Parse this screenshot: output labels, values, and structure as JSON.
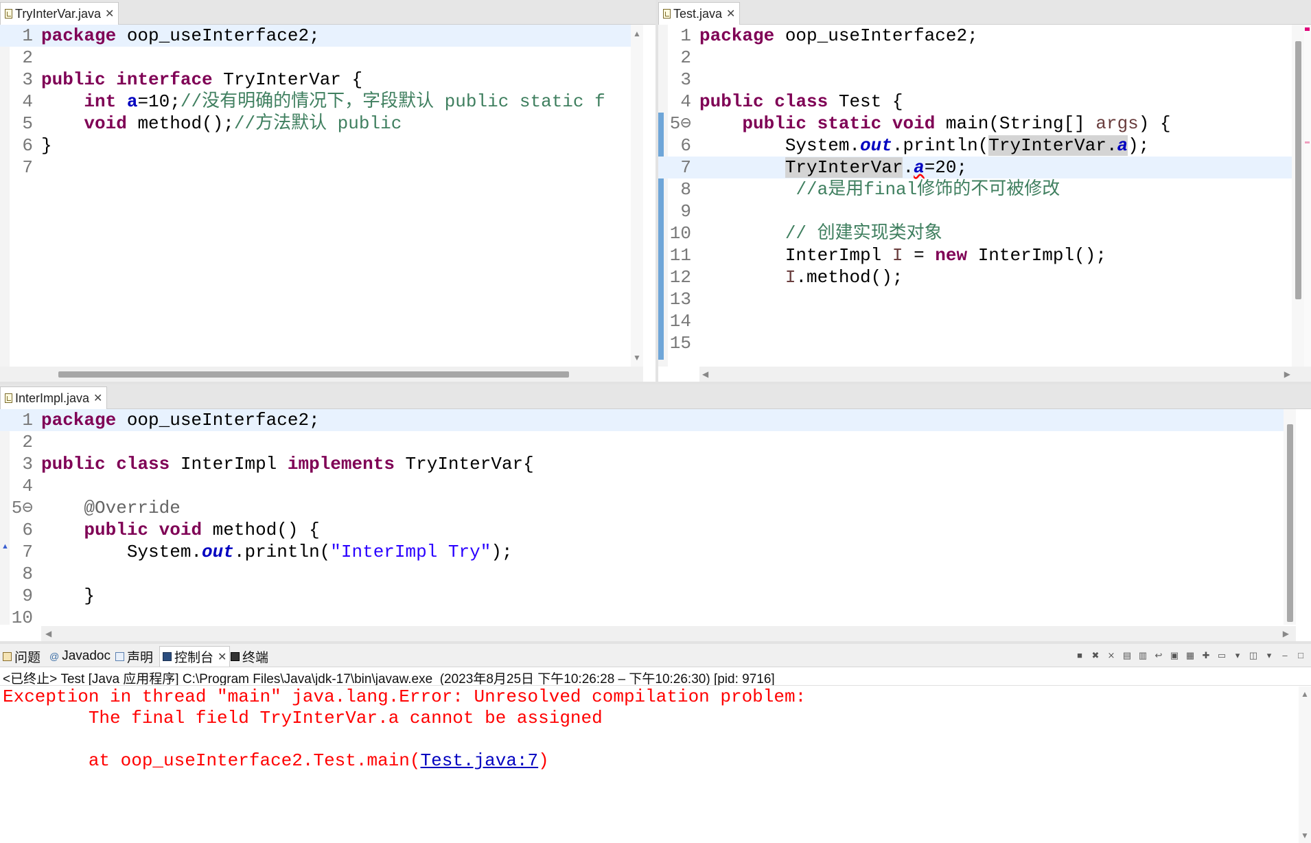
{
  "panes": {
    "try_inter_var": {
      "tab_label": "TryInterVar.java",
      "lines": [
        {
          "n": "1",
          "code": [
            {
              "t": "package",
              "c": "kw"
            },
            {
              "t": " oop_useInterface2;"
            }
          ]
        },
        {
          "n": "2",
          "code": []
        },
        {
          "n": "3",
          "code": [
            {
              "t": "public",
              "c": "kw"
            },
            {
              "t": " "
            },
            {
              "t": "interface",
              "c": "kw"
            },
            {
              "t": " TryInterVar {"
            }
          ]
        },
        {
          "n": "4",
          "code": [
            {
              "t": "    "
            },
            {
              "t": "int",
              "c": "kw"
            },
            {
              "t": " "
            },
            {
              "t": "a",
              "c": "fv"
            },
            {
              "t": "=10;"
            },
            {
              "t": "//没有明确的情况下，字段默认 public static f",
              "c": "cm"
            }
          ]
        },
        {
          "n": "5",
          "code": [
            {
              "t": "    "
            },
            {
              "t": "void",
              "c": "kw"
            },
            {
              "t": " method();"
            },
            {
              "t": "//方法默认 public",
              "c": "cm"
            }
          ]
        },
        {
          "n": "6",
          "code": [
            {
              "t": "}"
            }
          ]
        },
        {
          "n": "7",
          "code": []
        }
      ]
    },
    "test": {
      "tab_label": "Test.java",
      "lines": [
        {
          "n": "1",
          "code": [
            {
              "t": "package",
              "c": "kw"
            },
            {
              "t": " oop_useInterface2;"
            }
          ]
        },
        {
          "n": "2",
          "code": []
        },
        {
          "n": "3",
          "code": []
        },
        {
          "n": "4",
          "code": [
            {
              "t": "public",
              "c": "kw"
            },
            {
              "t": " "
            },
            {
              "t": "class",
              "c": "kw"
            },
            {
              "t": " Test {"
            }
          ]
        },
        {
          "n": "5⊖",
          "code": [
            {
              "t": "    "
            },
            {
              "t": "public",
              "c": "kw"
            },
            {
              "t": " "
            },
            {
              "t": "static",
              "c": "kw"
            },
            {
              "t": " "
            },
            {
              "t": "void",
              "c": "kw"
            },
            {
              "t": " main(String[] "
            },
            {
              "t": "args",
              "c": "lv"
            },
            {
              "t": ") {"
            }
          ]
        },
        {
          "n": "6",
          "code": [
            {
              "t": "        System."
            },
            {
              "t": "out",
              "c": "fi"
            },
            {
              "t": ".println("
            },
            {
              "t": "TryInterVar",
              "c": "occ"
            },
            {
              "t": ".",
              "c": "occ"
            },
            {
              "t": "a",
              "c": "fi occ"
            },
            {
              "t": ");"
            }
          ]
        },
        {
          "n": "7",
          "code": [
            {
              "t": "        "
            },
            {
              "t": "TryInterVar",
              "c": "occ"
            },
            {
              "t": "."
            },
            {
              "t": "a",
              "c": "fi sq"
            },
            {
              "t": "=20;"
            }
          ]
        },
        {
          "n": "8",
          "code": [
            {
              "t": "         "
            },
            {
              "t": "//a是用final修饰的不可被修改",
              "c": "cm"
            }
          ]
        },
        {
          "n": "9",
          "code": []
        },
        {
          "n": "10",
          "code": [
            {
              "t": "        "
            },
            {
              "t": "// 创建实现类对象",
              "c": "cm"
            }
          ]
        },
        {
          "n": "11",
          "code": [
            {
              "t": "        InterImpl "
            },
            {
              "t": "I",
              "c": "lv"
            },
            {
              "t": " = "
            },
            {
              "t": "new",
              "c": "kw"
            },
            {
              "t": " InterImpl();"
            }
          ]
        },
        {
          "n": "12",
          "code": [
            {
              "t": "        "
            },
            {
              "t": "I",
              "c": "lv"
            },
            {
              "t": ".method();"
            }
          ]
        },
        {
          "n": "13",
          "code": []
        },
        {
          "n": "14",
          "code": []
        },
        {
          "n": "15",
          "code": []
        }
      ]
    },
    "inter_impl": {
      "tab_label": "InterImpl.java",
      "lines": [
        {
          "n": "1",
          "code": [
            {
              "t": "package",
              "c": "kw"
            },
            {
              "t": " oop_useInterface2;"
            }
          ]
        },
        {
          "n": "2",
          "code": []
        },
        {
          "n": "3",
          "code": [
            {
              "t": "public",
              "c": "kw"
            },
            {
              "t": " "
            },
            {
              "t": "class",
              "c": "kw"
            },
            {
              "t": " InterImpl "
            },
            {
              "t": "implements",
              "c": "kw"
            },
            {
              "t": " TryInterVar{"
            }
          ]
        },
        {
          "n": "4",
          "code": []
        },
        {
          "n": "5⊖",
          "code": [
            {
              "t": "    "
            },
            {
              "t": "@Override",
              "c": "an"
            }
          ]
        },
        {
          "n": "6",
          "code": [
            {
              "t": "    "
            },
            {
              "t": "public",
              "c": "kw"
            },
            {
              "t": " "
            },
            {
              "t": "void",
              "c": "kw"
            },
            {
              "t": " method() {"
            }
          ]
        },
        {
          "n": "7",
          "code": [
            {
              "t": "        System."
            },
            {
              "t": "out",
              "c": "fi"
            },
            {
              "t": ".println("
            },
            {
              "t": "\"InterImpl Try\"",
              "c": "st"
            },
            {
              "t": ");"
            }
          ]
        },
        {
          "n": "8",
          "code": []
        },
        {
          "n": "9",
          "code": [
            {
              "t": "    }"
            }
          ]
        },
        {
          "n": "10",
          "code": []
        }
      ]
    }
  },
  "console": {
    "tabs": [
      {
        "label": "问题",
        "icon": "problems-icon"
      },
      {
        "label": "Javadoc",
        "icon": "javadoc-icon"
      },
      {
        "label": "声明",
        "icon": "declaration-icon"
      },
      {
        "label": "控制台",
        "icon": "console-icon",
        "active": true
      },
      {
        "label": "终端",
        "icon": "terminal-icon"
      }
    ],
    "description": "<已终止> Test [Java 应用程序] C:\\Program Files\\Java\\jdk-17\\bin\\javaw.exe  (2023年8月25日 下午10:26:28 – 下午10:26:30) [pid: 9716]",
    "output": {
      "line1": "Exception in thread \"main\" java.lang.Error: Unresolved compilation problem: ",
      "line2": "        The final field TryInterVar.a cannot be assigned",
      "line3": "",
      "line4_prefix": "        at oop_useInterface2.Test.main(",
      "line4_link": "Test.java:7",
      "line4_suffix": ")"
    }
  },
  "colors": {
    "keyword": "#7f0055",
    "comment": "#3f7f5f",
    "string": "#2a00ff",
    "field": "#0000c0",
    "error": "#ff0000"
  }
}
